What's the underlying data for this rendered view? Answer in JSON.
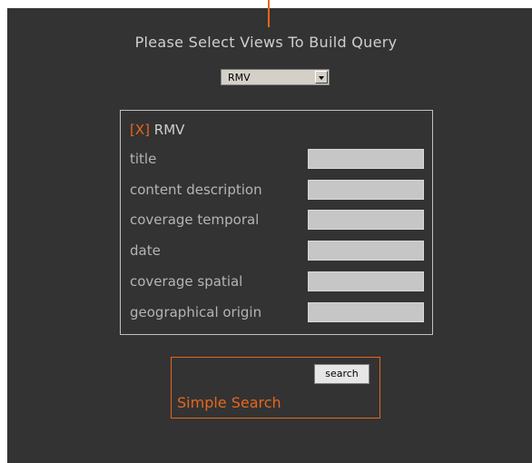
{
  "page": {
    "heading": "Please Select Views To Build Query"
  },
  "view_select": {
    "selected": "RMV"
  },
  "view": {
    "remove_label": "[X]",
    "name": "RMV",
    "fields": [
      {
        "label": "title",
        "value": ""
      },
      {
        "label": "content description",
        "value": ""
      },
      {
        "label": "coverage temporal",
        "value": ""
      },
      {
        "label": "date",
        "value": ""
      },
      {
        "label": "coverage spatial",
        "value": ""
      },
      {
        "label": "geographical origin",
        "value": ""
      }
    ]
  },
  "search": {
    "button_label": "search",
    "simple_search_label": "Simple Search"
  },
  "colors": {
    "background": "#333333",
    "accent": "#e8661c",
    "label_text": "#b4b4b4",
    "input_bg": "#c6c6c6"
  }
}
